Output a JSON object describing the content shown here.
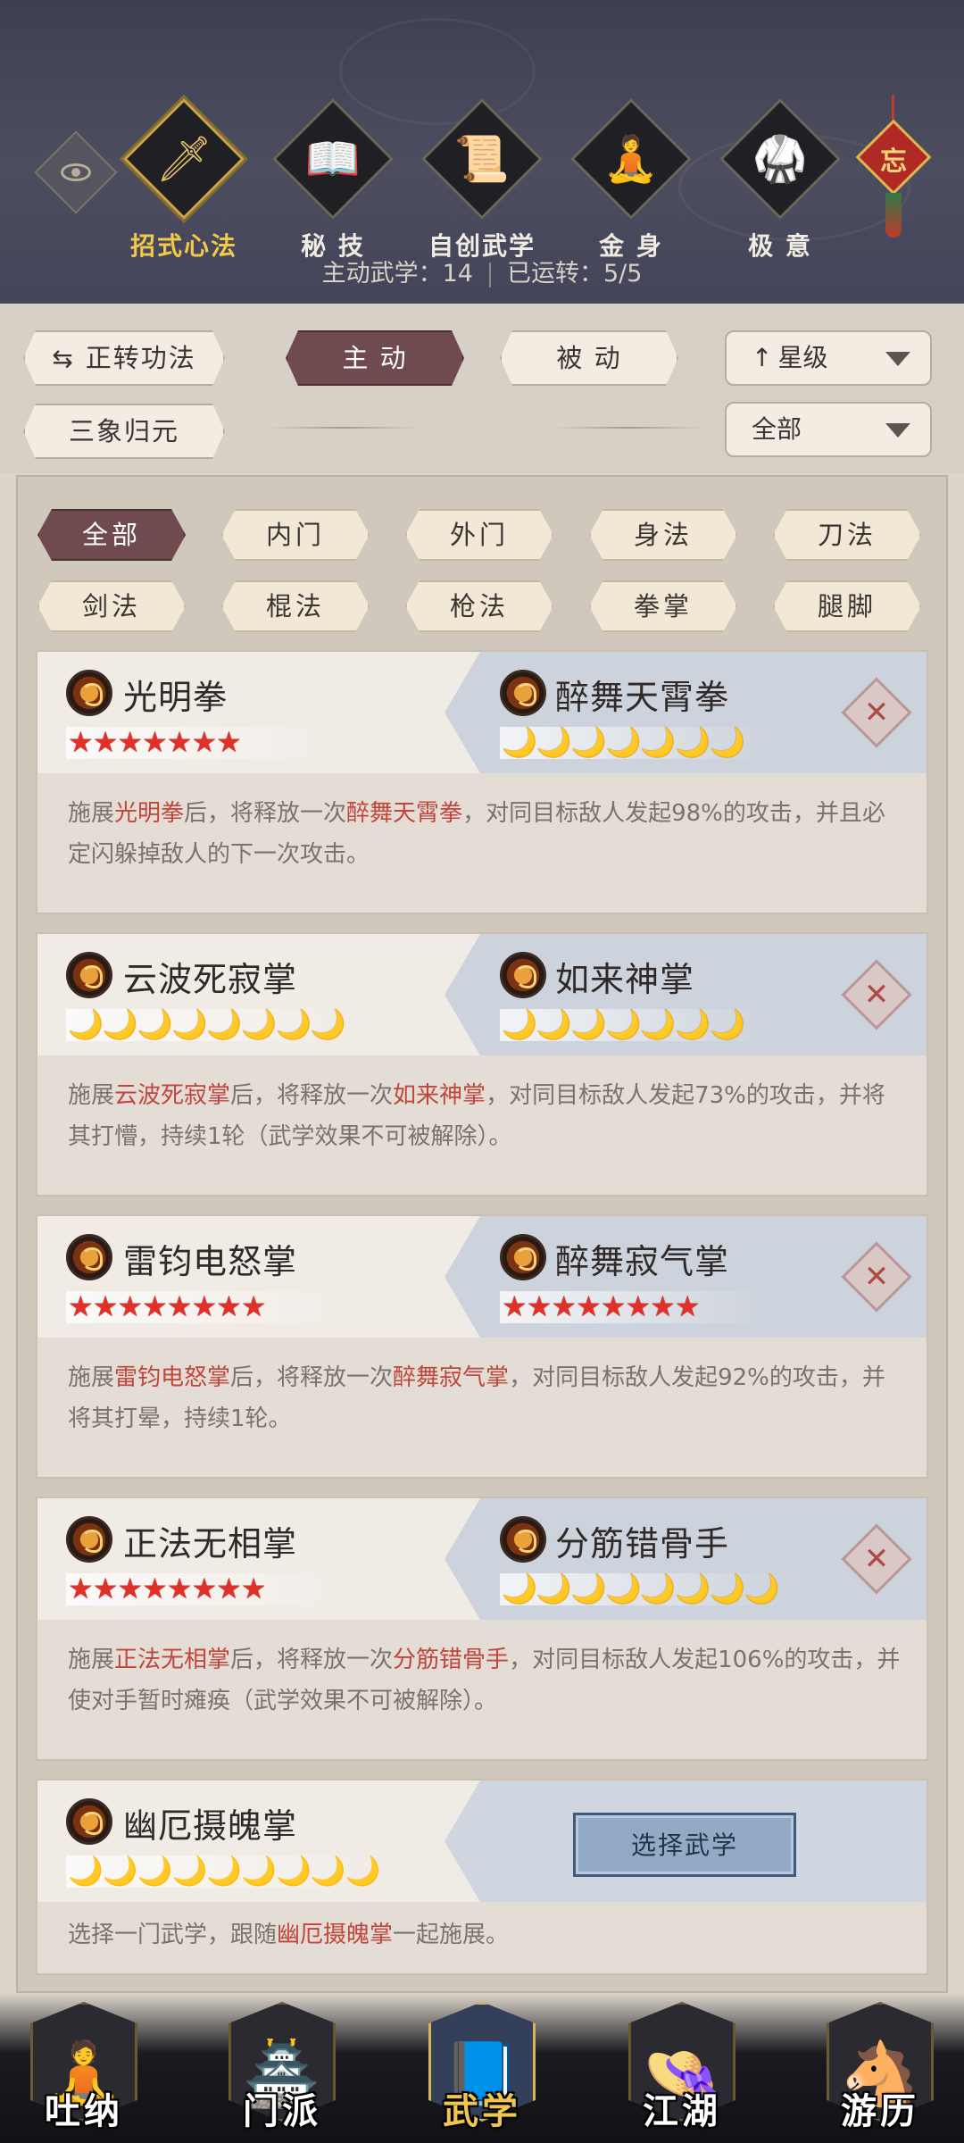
{
  "top_tabs": [
    {
      "label": "招式心法",
      "glyph": "🗡",
      "icon": "sword-icon"
    },
    {
      "label": "秘 技",
      "glyph": "📖",
      "icon": "book-icon"
    },
    {
      "label": "自创武学",
      "glyph": "📜",
      "icon": "scroll-icon"
    },
    {
      "label": "金 身",
      "glyph": "🧘",
      "icon": "meditation-icon"
    },
    {
      "label": "极 意",
      "glyph": "🥋",
      "icon": "martial-stance-icon"
    }
  ],
  "ornament_char": "忘",
  "status": {
    "active_label": "主动武学：14",
    "running_label": "已运转：5/5"
  },
  "filters": {
    "switch_label": "正转功法",
    "active_mode": "主 动",
    "passive_mode": "被 动",
    "sort_label": "星级",
    "sanxiang_label": "三象归元",
    "scope_label": "全部"
  },
  "categories": [
    "全部",
    "内门",
    "外门",
    "身法",
    "刀法",
    "剑法",
    "棍法",
    "枪法",
    "拳掌",
    "腿脚"
  ],
  "combos": [
    {
      "left_name": "光明拳",
      "left_stars": "★★★★★★★",
      "left_star_type": "red",
      "right_name": "醉舞天霄拳",
      "right_stars": "🌙🌙🌙🌙🌙🌙🌙",
      "right_star_type": "moon",
      "desc_a": "施展",
      "desc_b": "光明拳",
      "desc_c": "后，将释放一次",
      "desc_d": "醉舞天霄拳",
      "desc_e": "，对同目标敌人发起98%的攻击，并且必定闪躲掉敌人的下一次攻击。"
    },
    {
      "left_name": "云波死寂掌",
      "left_stars": "🌙🌙🌙🌙🌙🌙🌙🌙",
      "left_star_type": "moon",
      "right_name": "如来神掌",
      "right_stars": "🌙🌙🌙🌙🌙🌙🌙",
      "right_star_type": "moon",
      "desc_a": "施展",
      "desc_b": "云波死寂掌",
      "desc_c": "后，将释放一次",
      "desc_d": "如来神掌",
      "desc_e": "，对同目标敌人发起73%的攻击，并将其打懵，持续1轮（武学效果不可被解除）。"
    },
    {
      "left_name": "雷钧电怒掌",
      "left_stars": "★★★★★★★★",
      "left_star_type": "red",
      "right_name": "醉舞寂气掌",
      "right_stars": "★★★★★★★★",
      "right_star_type": "red",
      "desc_a": "施展",
      "desc_b": "雷钧电怒掌",
      "desc_c": "后，将释放一次",
      "desc_d": "醉舞寂气掌",
      "desc_e": "，对同目标敌人发起92%的攻击，并将其打晕，持续1轮。"
    },
    {
      "left_name": "正法无相掌",
      "left_stars": "★★★★★★★★",
      "left_star_type": "red",
      "right_name": "分筋错骨手",
      "right_stars": "🌙🌙🌙🌙🌙🌙🌙🌙",
      "right_star_type": "moon",
      "desc_a": "施展",
      "desc_b": "正法无相掌",
      "desc_c": "后，将释放一次",
      "desc_d": "分筋错骨手",
      "desc_e": "，对同目标敌人发起106%的攻击，并使对手暂时瘫痪（武学效果不可被解除）。"
    }
  ],
  "pick_card": {
    "name": "幽厄摄魄掌",
    "stars": "🌙🌙🌙🌙🌙🌙🌙🌙🌙",
    "button": "选择武学",
    "desc_a": "选择一门武学，跟随",
    "desc_b": "幽厄摄魄掌",
    "desc_c": "一起施展。"
  },
  "bottom_nav": [
    {
      "label": "吐纳",
      "glyph": "🧘"
    },
    {
      "label": "门派",
      "glyph": "🏯"
    },
    {
      "label": "武学",
      "glyph": "📘"
    },
    {
      "label": "江湖",
      "glyph": "👒"
    },
    {
      "label": "游历",
      "glyph": "🐴"
    }
  ],
  "colors": {
    "accent_gold": "#f1c94b",
    "highlight_red": "#c0463c",
    "active_pill": "#6f4a4e",
    "select_button": "#93aac6"
  }
}
